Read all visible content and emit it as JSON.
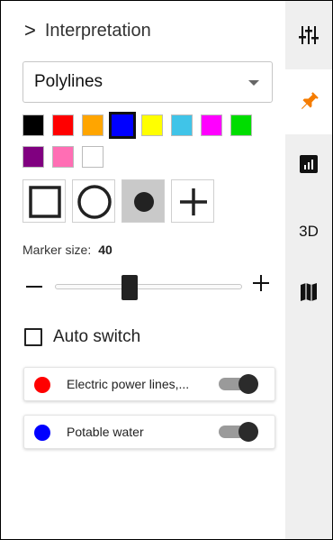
{
  "panel": {
    "title": "Interpretation",
    "mode_select": {
      "value": "Polylines"
    }
  },
  "colors": {
    "swatches": [
      "#000000",
      "#ff0000",
      "#ffa500",
      "#0000ff",
      "#ffff00",
      "#40c4e8",
      "#ff00ff",
      "#00dd00",
      "#800080",
      "#ff6eb4",
      "#ffffff"
    ],
    "selected": "#0000ff",
    "accent_pin": "#f57c00"
  },
  "markers": {
    "shapes": [
      "square-marker-icon",
      "circle-marker-icon",
      "filled-dot-marker-icon",
      "plus-marker-icon"
    ],
    "active": "filled-dot-marker-icon",
    "size_label": "Marker size:",
    "size_value": "40"
  },
  "slider": {
    "value": 40,
    "min": 0,
    "max": 100
  },
  "auto_switch": {
    "label": "Auto switch",
    "checked": false
  },
  "layers": [
    {
      "name": "Electric power lines,...",
      "color": "#ff0000",
      "enabled": true
    },
    {
      "name": "Potable water",
      "color": "#0000ff",
      "enabled": true
    }
  ],
  "rail": {
    "items": [
      {
        "icon": "sliders-icon",
        "label": ""
      },
      {
        "icon": "pin-icon",
        "label": "",
        "selected": true
      },
      {
        "icon": "chart-icon",
        "label": ""
      },
      {
        "icon": "3d-icon",
        "label": "3D"
      },
      {
        "icon": "map-icon",
        "label": ""
      }
    ]
  }
}
